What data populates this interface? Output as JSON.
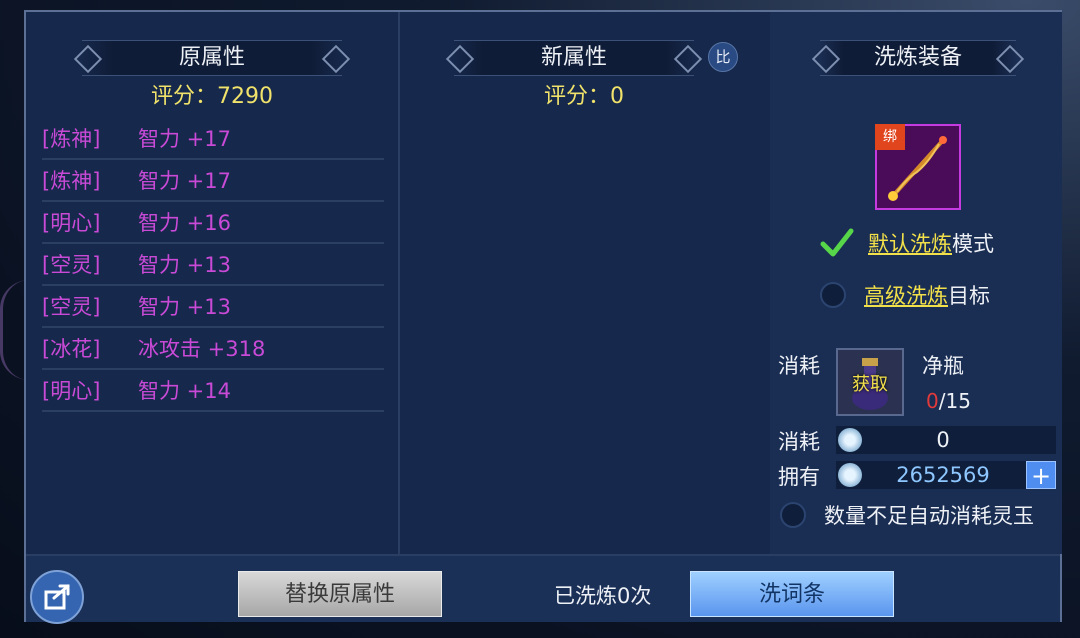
{
  "original": {
    "title": "原属性",
    "score": "评分：7290",
    "attributes": [
      {
        "tag": "[炼神]",
        "stat": "智力 +17"
      },
      {
        "tag": "[炼神]",
        "stat": "智力 +17"
      },
      {
        "tag": "[明心]",
        "stat": "智力 +16"
      },
      {
        "tag": "[空灵]",
        "stat": "智力 +13"
      },
      {
        "tag": "[空灵]",
        "stat": "智力 +13"
      },
      {
        "tag": "[冰花]",
        "stat": "冰攻击 +318"
      },
      {
        "tag": "[明心]",
        "stat": "智力 +14"
      }
    ]
  },
  "new_attrs": {
    "title": "新属性",
    "score": "评分：0",
    "compare_label": "比"
  },
  "refine": {
    "title": "洗炼装备",
    "equip_bind_label": "绑",
    "default_mode_link": "默认洗炼",
    "default_mode_suffix": "模式",
    "advanced_mode_link": "高级洗炼",
    "advanced_mode_suffix": "目标",
    "cost_label": "消耗",
    "item_get_label": "获取",
    "item_name": "净瓶",
    "item_have": "0",
    "item_need": "/15",
    "currency_cost_label": "消耗",
    "currency_cost_value": "0",
    "own_label": "拥有",
    "own_value": "2652569",
    "plus_label": "+",
    "auto_consume_label": "数量不足自动消耗灵玉"
  },
  "bottom": {
    "replace_button": "替换原属性",
    "wash_count": "已洗炼0次",
    "wash_button": "洗词条"
  },
  "colors": {
    "attr_text": "#c84ad6",
    "score_text": "#f0e26a",
    "link_text": "#f2e04a",
    "own_value": "#8ec7ff"
  }
}
